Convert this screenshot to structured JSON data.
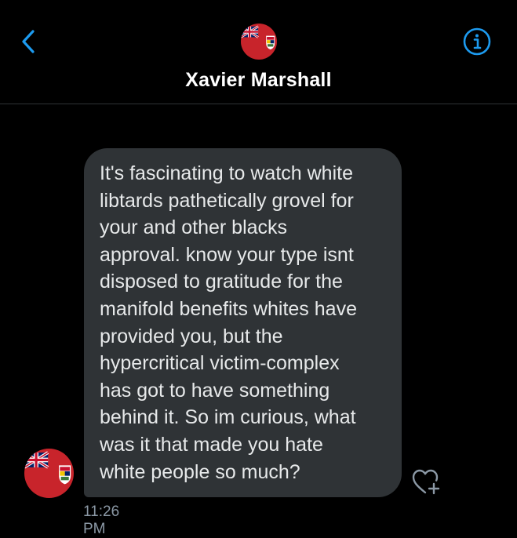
{
  "header": {
    "contact_name": "Xavier Marshall"
  },
  "message": {
    "text": "It's fascinating to watch white\nlibtards pathetically grovel for\nyour and other blacks\napproval. know your type isnt\ndisposed to gratitude for the\nmanifold benefits whites have\nprovided you, but the\nhypercritical victim-complex\nhas got to have something\nbehind it. So im curious, what\nwas it that made you hate\nwhite people so much?",
    "timestamp": "11:26 PM"
  },
  "icons": {
    "back": "chevron-left-icon",
    "info": "info-icon",
    "react": "heart-plus-icon",
    "avatar": "red-ensign-flag-avatar"
  },
  "colors": {
    "background": "#000000",
    "accent": "#1d9bf0",
    "bubble": "#2f3336",
    "timestamp": "#8b98a5",
    "avatar_red": "#c8242b",
    "avatar_blue": "#012169"
  }
}
